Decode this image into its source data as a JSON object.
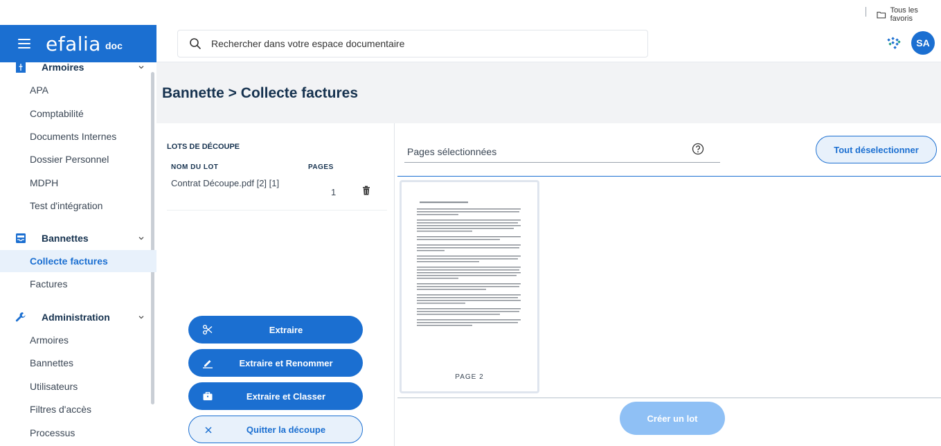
{
  "favorites": {
    "label": "Tous les favoris"
  },
  "brand": {
    "name": "efalia",
    "suffix": "doc"
  },
  "search": {
    "placeholder": "Rechercher dans votre espace documentaire"
  },
  "user": {
    "initials": "SA"
  },
  "sidebar": {
    "sections": [
      {
        "label": "Armoires",
        "icon": "cabinet-icon",
        "items": [
          "APA",
          "Comptabilité",
          "Documents Internes",
          "Dossier Personnel",
          "MDPH",
          "Test d'intégration"
        ]
      },
      {
        "label": "Bannettes",
        "icon": "inbox-tray-icon",
        "items": [
          "Collecte factures",
          "Factures"
        ]
      },
      {
        "label": "Administration",
        "icon": "wrench-icon",
        "items": [
          "Armoires",
          "Bannettes",
          "Utilisateurs",
          "Filtres d'accès",
          "Processus"
        ]
      }
    ],
    "active_item": "Collecte factures"
  },
  "page": {
    "title": "Bannette > Collecte factures"
  },
  "lots": {
    "heading": "LOTS DE DÉCOUPE",
    "col_name": "NOM DU LOT",
    "col_pages": "PAGES",
    "rows": [
      {
        "name": "Contrat Découpe.pdf [2] [1]",
        "pages": "1"
      }
    ]
  },
  "actions": {
    "extract": "Extraire",
    "extract_rename": "Extraire et Renommer",
    "extract_file": "Extraire et Classer",
    "quit": "Quitter la découpe"
  },
  "selection": {
    "label": "Pages sélectionnées",
    "deselect_all": "Tout déselectionner",
    "create_lot": "Créer un lot"
  },
  "thumbnails": [
    {
      "label": "PAGE 2"
    }
  ],
  "colors": {
    "primary": "#1b6fd1",
    "primary_light": "#e8f1fb",
    "disabled": "#8fc0f5",
    "title_bg": "#f2f3f5"
  }
}
